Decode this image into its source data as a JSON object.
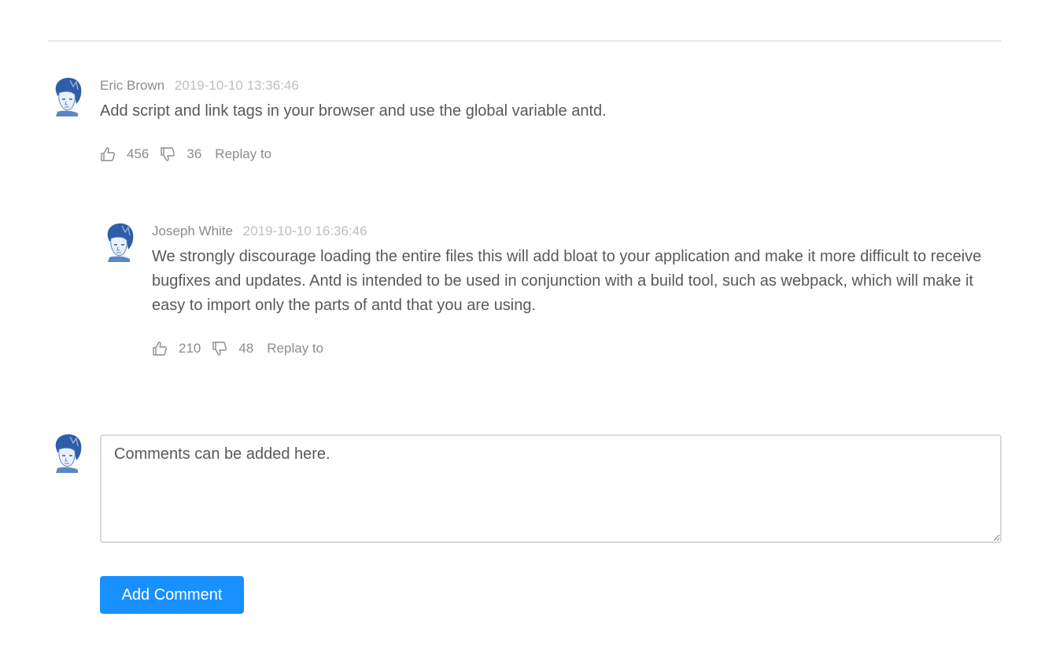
{
  "colors": {
    "primary": "#1890ff",
    "author": "#8c8c8c",
    "timestamp": "#bfbfbf",
    "text": "#595959",
    "divider": "#e8e8e8"
  },
  "comments": [
    {
      "author": "Eric Brown",
      "datetime": "2019-10-10 13:36:46",
      "content": "Add script and link tags in your browser and use the global variable antd.",
      "likes": "456",
      "dislikes": "36",
      "reply_label": "Replay to",
      "avatar_icon": "user-avatar-icon"
    },
    {
      "author": "Joseph White",
      "datetime": "2019-10-10 16:36:46",
      "content": "We strongly discourage loading the entire files this will add bloat to your application and make it more difficult to receive bugfixes and updates. Antd is intended to be used in conjunction with a build tool, such as webpack, which will make it easy to import only the parts of antd that you are using.",
      "likes": "210",
      "dislikes": "48",
      "reply_label": "Replay to",
      "avatar_icon": "user-avatar-icon"
    }
  ],
  "editor": {
    "placeholder": "Comments can be added here.",
    "value": "",
    "submit_label": "Add Comment",
    "avatar_icon": "user-avatar-icon"
  }
}
